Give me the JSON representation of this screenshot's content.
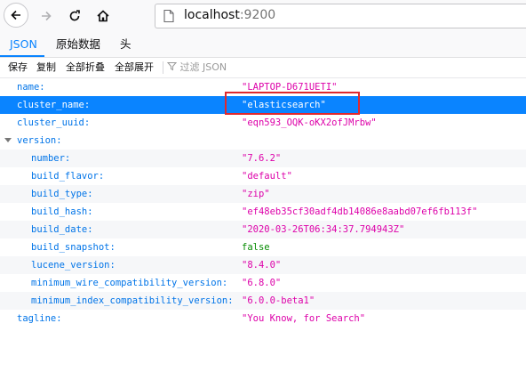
{
  "url": {
    "host": "localhost",
    "port": ":9200"
  },
  "tabs": [
    {
      "label": "JSON"
    },
    {
      "label": "原始数据"
    },
    {
      "label": "头"
    }
  ],
  "actions": {
    "save": "保存",
    "copy": "复制",
    "collapse_all": "全部折叠",
    "expand_all": "全部展开",
    "filter_placeholder": "过滤 JSON"
  },
  "rows": [
    {
      "key": "name:",
      "value": "\"LAPTOP-D671UETI\"",
      "type": "string"
    },
    {
      "key": "cluster_name:",
      "value": "\"elasticsearch\"",
      "type": "string"
    },
    {
      "key": "cluster_uuid:",
      "value": "\"eqn593_OQK-oKX2ofJMrbw\"",
      "type": "string"
    },
    {
      "key": "version:",
      "value": "",
      "type": "object"
    },
    {
      "key": "number:",
      "value": "\"7.6.2\"",
      "type": "string"
    },
    {
      "key": "build_flavor:",
      "value": "\"default\"",
      "type": "string"
    },
    {
      "key": "build_type:",
      "value": "\"zip\"",
      "type": "string"
    },
    {
      "key": "build_hash:",
      "value": "\"ef48eb35cf30adf4db14086e8aabd07ef6fb113f\"",
      "type": "string"
    },
    {
      "key": "build_date:",
      "value": "\"2020-03-26T06:34:37.794943Z\"",
      "type": "string"
    },
    {
      "key": "build_snapshot:",
      "value": "false",
      "type": "boolean"
    },
    {
      "key": "lucene_version:",
      "value": "\"8.4.0\"",
      "type": "string"
    },
    {
      "key": "minimum_wire_compatibility_version:",
      "value": "\"6.8.0\"",
      "type": "string"
    },
    {
      "key": "minimum_index_compatibility_version:",
      "value": "\"6.0.0-beta1\"",
      "type": "string"
    },
    {
      "key": "tagline:",
      "value": "\"You Know, for Search\"",
      "type": "string"
    }
  ],
  "colors": {
    "accent": "#0a84ff",
    "string": "#dd00a9",
    "key": "#0074e8",
    "boolean": "#058b00",
    "highlight_box": "#e0282e"
  }
}
